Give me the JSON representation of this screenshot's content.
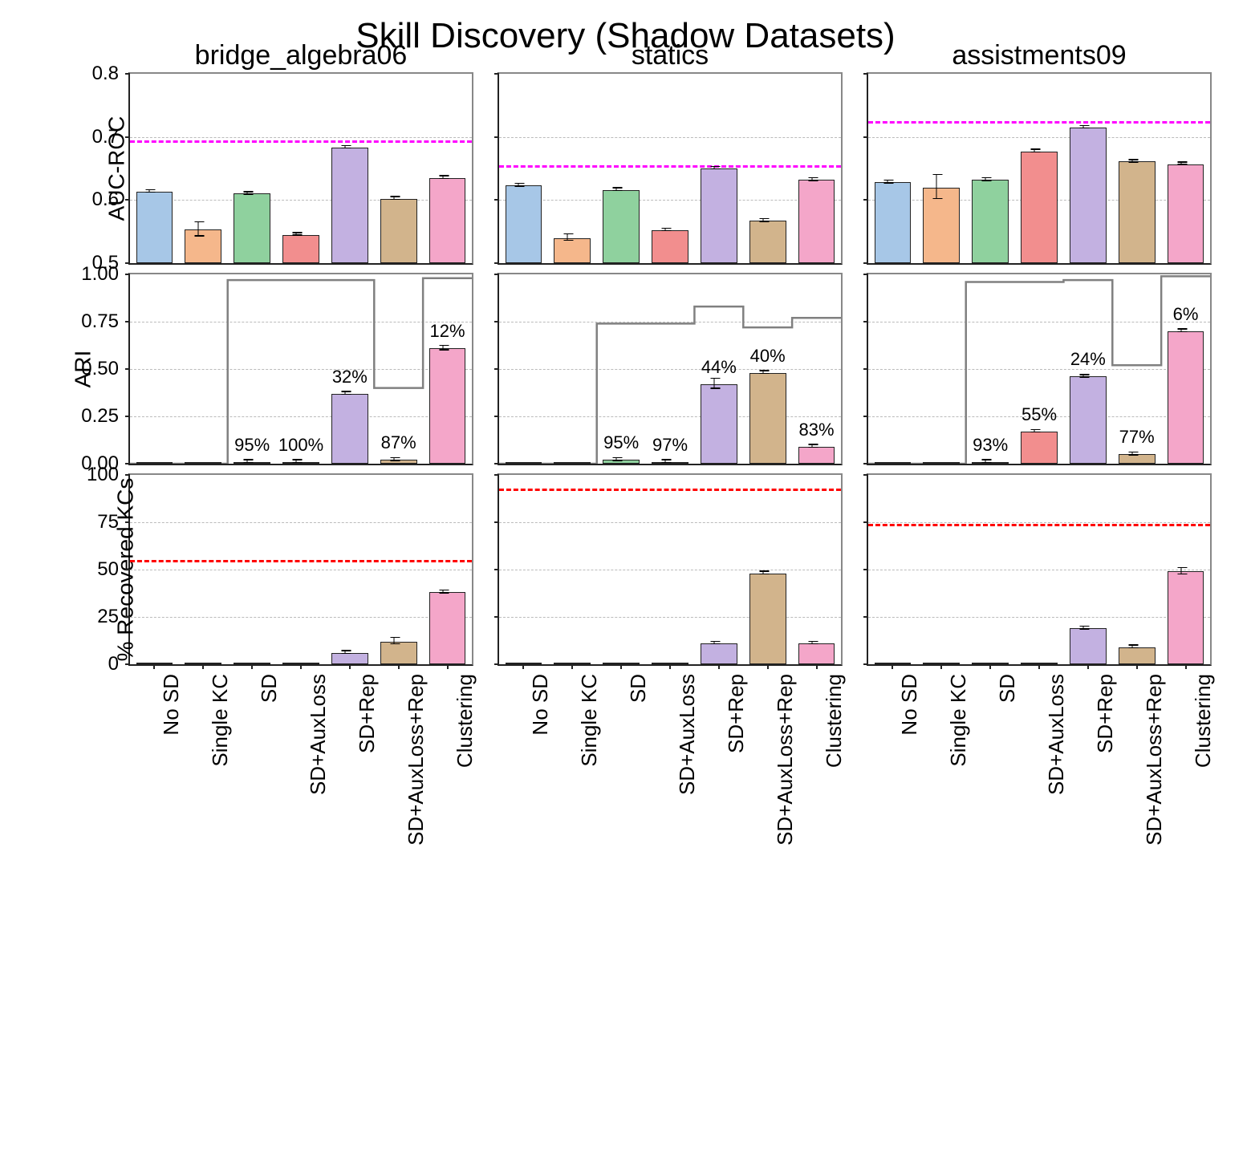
{
  "suptitle": "Skill Discovery (Shadow Datasets)",
  "categories": [
    "No SD",
    "Single KC",
    "SD",
    "SD+AuxLoss",
    "SD+Rep",
    "SD+AuxLoss+Rep",
    "Clustering"
  ],
  "colors": [
    "#a7c7e7",
    "#f5b78b",
    "#8fd19e",
    "#f28e8e",
    "#c3b1e1",
    "#d2b48c",
    "#f4a6c9"
  ],
  "columns": [
    "bridge_algebra06",
    "statics",
    "assistments09"
  ],
  "rows": [
    "AUC-ROC",
    "ARI",
    "% Recovered KCs"
  ],
  "yaxes": {
    "0": {
      "min": 0.5,
      "max": 0.8,
      "ticks": [
        0.5,
        0.6,
        0.7,
        0.8
      ],
      "labels": [
        "0.5",
        "0.6",
        "0.7",
        "0.8"
      ]
    },
    "1": {
      "min": 0.0,
      "max": 1.0,
      "ticks": [
        0.0,
        0.25,
        0.5,
        0.75,
        1.0
      ],
      "labels": [
        "0.00",
        "0.25",
        "0.50",
        "0.75",
        "1.00"
      ]
    },
    "2": {
      "min": 0,
      "max": 100,
      "ticks": [
        0,
        25,
        50,
        75,
        100
      ],
      "labels": [
        "0",
        "25",
        "50",
        "75",
        "100"
      ]
    }
  },
  "chart_data": [
    [
      {
        "hline": {
          "style": "magenta",
          "y": 0.695
        },
        "values": [
          0.613,
          0.553,
          0.61,
          0.545,
          0.683,
          0.602,
          0.635
        ],
        "errors": [
          0.003,
          0.012,
          0.003,
          0.003,
          0.003,
          0.003,
          0.003
        ]
      },
      {
        "hline": {
          "style": "magenta",
          "y": 0.655
        },
        "values": [
          0.623,
          0.54,
          0.616,
          0.552,
          0.65,
          0.567,
          0.632
        ],
        "errors": [
          0.003,
          0.006,
          0.003,
          0.003,
          0.003,
          0.003,
          0.003
        ]
      },
      {
        "hline": {
          "style": "magenta",
          "y": 0.725
        },
        "values": [
          0.628,
          0.62,
          0.632,
          0.677,
          0.715,
          0.661,
          0.657
        ],
        "errors": [
          0.003,
          0.02,
          0.003,
          0.003,
          0.003,
          0.003,
          0.003
        ]
      }
    ],
    [
      {
        "values": [
          0.0,
          0.0,
          0.01,
          0.01,
          0.37,
          0.02,
          0.61
        ],
        "errors": [
          0,
          0,
          0.01,
          0.01,
          0.01,
          0.01,
          0.015
        ],
        "labels": [
          null,
          null,
          "95%",
          "100%",
          "32%",
          "87%",
          "12%"
        ],
        "step": [
          0.0,
          0.0,
          0.97,
          0.97,
          0.97,
          0.4,
          0.98
        ]
      },
      {
        "values": [
          0.0,
          0.0,
          0.02,
          0.01,
          0.42,
          0.48,
          0.09
        ],
        "errors": [
          0,
          0,
          0.01,
          0.01,
          0.03,
          0.01,
          0.01
        ],
        "labels": [
          null,
          null,
          "95%",
          "97%",
          "44%",
          "40%",
          "83%"
        ],
        "step": [
          0.0,
          0.0,
          0.74,
          0.74,
          0.83,
          0.72,
          0.77
        ]
      },
      {
        "values": [
          0.0,
          0.0,
          0.01,
          0.17,
          0.46,
          0.05,
          0.7
        ],
        "errors": [
          0,
          0,
          0.01,
          0.01,
          0.01,
          0.01,
          0.01
        ],
        "labels": [
          null,
          null,
          "93%",
          "55%",
          "24%",
          "77%",
          "6%"
        ],
        "step": [
          0.0,
          0.0,
          0.96,
          0.96,
          0.97,
          0.52,
          0.99
        ]
      }
    ],
    [
      {
        "hline": {
          "style": "red",
          "y": 55
        },
        "values": [
          0,
          0,
          0,
          0,
          6,
          12,
          38
        ],
        "errors": [
          0,
          0,
          0,
          0,
          1,
          2,
          1
        ]
      },
      {
        "hline": {
          "style": "red",
          "y": 93
        },
        "values": [
          0,
          0,
          0,
          0,
          11,
          48,
          11
        ],
        "errors": [
          0,
          0,
          0,
          0,
          1,
          1,
          1
        ]
      },
      {
        "hline": {
          "style": "red",
          "y": 74
        },
        "values": [
          0,
          0,
          0,
          0,
          19,
          9,
          49
        ],
        "errors": [
          0,
          0,
          0,
          0,
          1,
          1,
          2
        ]
      }
    ]
  ]
}
